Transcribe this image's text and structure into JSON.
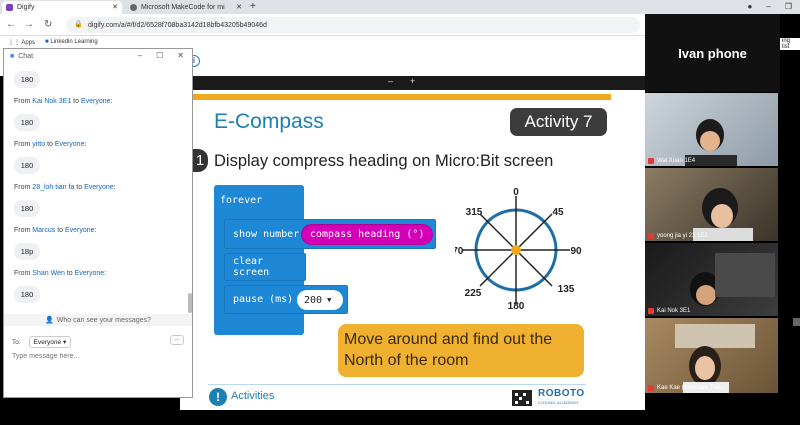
{
  "browser": {
    "tabs": [
      {
        "title": "Digify",
        "active": true
      },
      {
        "title": "Microsoft MakeCode for mi",
        "active": false
      }
    ],
    "url": "digify.com/a/#/f/d2/6528f708ba3142d18bfb43205b49046d",
    "bookmarks": [
      "Apps",
      "Linkedin Learning"
    ],
    "reading_list": "ing list"
  },
  "share_toolbar": {
    "minus": "–",
    "plus": "+"
  },
  "slide": {
    "title": "E-Compass",
    "activity": "Activity 7",
    "step_number": "1",
    "step_text": "Display compress heading on Micro:Bit screen",
    "blocks": {
      "forever": "forever",
      "show_number": "show number",
      "compass_heading": "compass heading (°)",
      "clear_screen": "clear screen",
      "pause": "pause (ms)",
      "pause_value": "200"
    },
    "compass_labels": {
      "n": "0",
      "ne": "45",
      "e": "90",
      "se": "135",
      "s": "180",
      "sw": "225",
      "w": "270",
      "nw": "315"
    },
    "callout": "Move around and find out the North of the room",
    "footer": "Activities",
    "logo_title": "ROBOTO",
    "logo_sub": "CODING ACADEMY"
  },
  "chat": {
    "title": "Chat",
    "messages": [
      {
        "from": "",
        "to": "",
        "text": "180"
      },
      {
        "from": "Kai Nok 3E1",
        "to": "Everyone",
        "text": "180"
      },
      {
        "from": "yitto",
        "to": "Everyone",
        "text": "180"
      },
      {
        "from": "28_loh tian fa",
        "to": "Everyone",
        "text": "180"
      },
      {
        "from": "Marcus",
        "to": "Everyone",
        "text": "18p"
      },
      {
        "from": "Shan Wen",
        "to": "Everyone",
        "text": "180"
      }
    ],
    "from_word": "From",
    "to_word": "to",
    "who_can_see": "Who can see your messages?",
    "to_label": "To:",
    "recipient": "Everyone",
    "more": "...",
    "input_placeholder": "Type message here..."
  },
  "participants": {
    "active_speaker": "Ivan phone",
    "tiles": [
      {
        "name": "Wai Xuan 1E4"
      },
      {
        "name": "yoong jia yi 23 1E2"
      },
      {
        "name": "Kai Nok 3E1"
      },
      {
        "name": "Kae Kae (Assistant Trai..."
      }
    ]
  }
}
